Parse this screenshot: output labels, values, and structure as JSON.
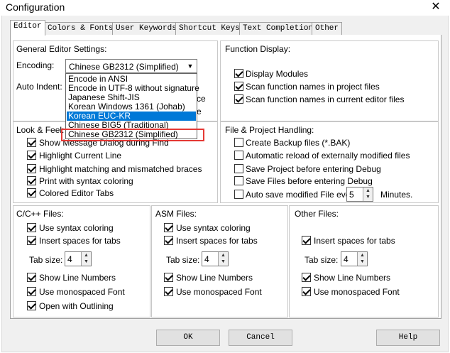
{
  "window": {
    "title": "Configuration",
    "close_glyph": "✕"
  },
  "tabs": [
    {
      "label": "Editor",
      "active": true
    },
    {
      "label": "Colors & Fonts",
      "active": false
    },
    {
      "label": "User Keywords",
      "active": false
    },
    {
      "label": "Shortcut Keys",
      "active": false
    },
    {
      "label": "Text Completion",
      "active": false
    },
    {
      "label": "Other",
      "active": false
    }
  ],
  "general": {
    "title": "General Editor Settings:",
    "encoding_label": "Encoding:",
    "encoding_value": "Chinese GB2312 (Simplified)",
    "auto_indent_label": "Auto Indent:",
    "partial_1": "ce",
    "partial_2": "e",
    "encoding_options": [
      "Encode in ANSI",
      "Encode in UTF-8 without signature",
      "Japanese Shift-JIS",
      "Korean Windows 1361 (Johab)",
      "Korean EUC-KR",
      "Chinese BIG5 (Traditional)",
      "Chinese GB2312 (Simplified)"
    ],
    "highlighted_option": "Korean EUC-KR"
  },
  "function_display": {
    "title": "Function Display:",
    "items": [
      {
        "label": "Display Modules",
        "checked": true
      },
      {
        "label": "Scan function names in project files",
        "checked": true
      },
      {
        "label": "Scan function names in current editor files",
        "checked": true
      }
    ]
  },
  "look_feel": {
    "title": "Look & Feel:",
    "items": [
      {
        "label": "Show Message Dialog during Find",
        "checked": true
      },
      {
        "label": "Highlight Current Line",
        "checked": true
      },
      {
        "label": "Highlight matching and mismatched braces",
        "checked": true
      },
      {
        "label": "Print with syntax coloring",
        "checked": true
      },
      {
        "label": "Colored Editor Tabs",
        "checked": true
      }
    ]
  },
  "file_project": {
    "title": "File & Project Handling:",
    "items": [
      {
        "label": "Create Backup files (*.BAK)",
        "checked": false
      },
      {
        "label": "Automatic reload of externally modified files",
        "checked": false
      },
      {
        "label": "Save Project before entering Debug",
        "checked": false
      },
      {
        "label": "Save Files before entering Debug",
        "checked": false
      }
    ],
    "autosave_label": "Auto save modified File every",
    "autosave_value": "5",
    "autosave_unit": "Minutes."
  },
  "cpp_files": {
    "title": "C/C++ Files:",
    "syntax_coloring": {
      "label": "Use syntax coloring",
      "checked": true
    },
    "insert_spaces": {
      "label": "Insert spaces for tabs",
      "checked": true
    },
    "tab_size_label": "Tab size:",
    "tab_size": "4",
    "show_line_numbers": {
      "label": "Show Line Numbers",
      "checked": true
    },
    "monospaced": {
      "label": "Use monospaced Font",
      "checked": true
    },
    "outlining": {
      "label": "Open with Outlining",
      "checked": true
    }
  },
  "asm_files": {
    "title": "ASM Files:",
    "syntax_coloring": {
      "label": "Use syntax coloring",
      "checked": true
    },
    "insert_spaces": {
      "label": "Insert spaces for tabs",
      "checked": true
    },
    "tab_size_label": "Tab size:",
    "tab_size": "4",
    "show_line_numbers": {
      "label": "Show Line Numbers",
      "checked": true
    },
    "monospaced": {
      "label": "Use monospaced Font",
      "checked": true
    }
  },
  "other_files": {
    "title": "Other Files:",
    "insert_spaces": {
      "label": "Insert spaces for tabs",
      "checked": true
    },
    "tab_size_label": "Tab size:",
    "tab_size": "4",
    "show_line_numbers": {
      "label": "Show Line Numbers",
      "checked": true
    },
    "monospaced": {
      "label": "Use monospaced Font",
      "checked": true
    }
  },
  "buttons": {
    "ok": "OK",
    "cancel": "Cancel",
    "help": "Help"
  },
  "colors": {
    "selection": "#0078d7",
    "highlight_border": "#e53935"
  }
}
